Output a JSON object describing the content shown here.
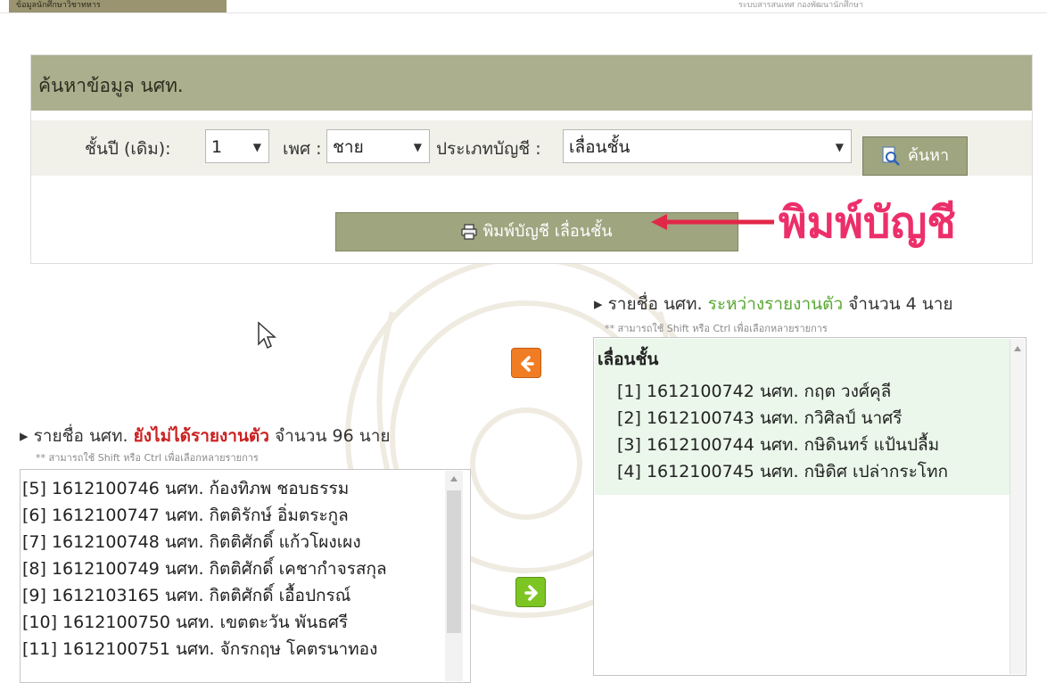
{
  "topbar": {
    "tab_text": "ข้อมูลนักศึกษาวิชาทหาร",
    "right_text": "ระบบสารสนเทศ กองพัฒนานักศึกษา"
  },
  "search": {
    "header_title": "ค้นหาข้อมูล นศท.",
    "year_label": "ชั้นปี (เดิม):",
    "year_value": "1",
    "gender_label": "เพศ :",
    "gender_value": "ชาย",
    "type_label": "ประเภทบัญชี :",
    "type_value": "เลื่อนชั้น",
    "search_button": "ค้นหา",
    "print_button": "พิมพ์บัญชี เลื่อนชั้น"
  },
  "annotation": {
    "label": "พิมพ์บัญชี",
    "color": "#ec2f6a"
  },
  "right_panel": {
    "prefix": "รายชื่อ นศท.",
    "status": "ระหว่างรายงานตัว",
    "count_text": "จำนวน 4 นาย",
    "hint": "** สามารถใช้ Shift หรือ Ctrl เพื่อเลือกหลายรายการ",
    "group_label": "เลื่อนชั้น",
    "items": [
      "[1] 1612100742 นศท. กฤต วงศ์คุลี",
      "[2] 1612100743 นศท. กวิศิลป์ นาศรี",
      "[3] 1612100744 นศท. กษิดินทร์ แป้นปลื้ม",
      "[4] 1612100745 นศท. กษิดิศ เปล่ากระโทก"
    ]
  },
  "left_panel": {
    "prefix": "รายชื่อ นศท.",
    "status": "ยังไม่ได้รายงานตัว",
    "count_text": "จำนวน 96 นาย",
    "hint": "** สามารถใช้ Shift หรือ Ctrl เพื่อเลือกหลายรายการ",
    "items": [
      "[5] 1612100746 นศท. ก้องทิภพ ชอบธรรม",
      "[6] 1612100747 นศท. กิตติรักษ์ อิ่มตระกูล",
      "[7] 1612100748 นศท. กิตติศักดิ์ แก้วโผงเผง",
      "[8] 1612100749 นศท. กิตติศักดิ์ เคชากำจรสกุล",
      "[9] 1612103165 นศท. กิตติศักดิ์ เอื้อปกรณ์",
      "[10] 1612100750 นศท. เขตตะวัน พันธศรี",
      "[11] 1612100751 นศท. จักรกฤษ โคตรนาทอง"
    ]
  },
  "colors": {
    "header_bg": "#acaf8d",
    "button_bg": "#9fa57f",
    "move_left": "#f07d24",
    "move_right": "#7dc522",
    "status_pending": "#58a832",
    "status_missing": "#cc2020"
  },
  "icons": {
    "search": "magnifier-icon",
    "print": "printer-icon",
    "move_left": "arrow-left-icon",
    "move_right": "arrow-right-icon"
  }
}
